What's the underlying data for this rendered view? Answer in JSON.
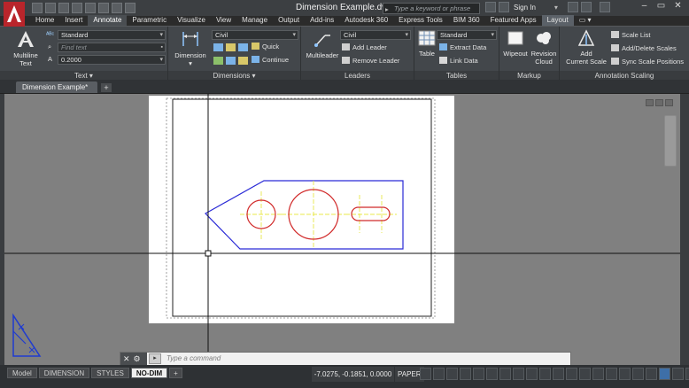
{
  "window": {
    "title": "Dimension Example.dwg"
  },
  "search": {
    "placeholder": "Type a keyword or phrase"
  },
  "account": {
    "signin_label": "Sign In"
  },
  "ribbon_tabs": [
    "Home",
    "Insert",
    "Annotate",
    "Parametric",
    "Visualize",
    "View",
    "Manage",
    "Output",
    "Add-ins",
    "Autodesk 360",
    "Express Tools",
    "BIM 360",
    "Featured Apps",
    "Layout"
  ],
  "active_tab": "Annotate",
  "panels": {
    "text": {
      "title": "Text",
      "multiline_label_1": "Multiline",
      "multiline_label_2": "Text",
      "style_value": "Standard",
      "find_placeholder": "Find text",
      "height_value": "0.2000"
    },
    "dimensions": {
      "title": "Dimensions",
      "dimension_label": "Dimension",
      "style_value": "Civil",
      "quick_label": "Quick",
      "continue_label": "Continue"
    },
    "leaders": {
      "title": "Leaders",
      "multileader_label": "Multileader",
      "style_value": "Civil",
      "add_leader_label": "Add Leader",
      "remove_leader_label": "Remove Leader"
    },
    "tables": {
      "title": "Tables",
      "table_label": "Table",
      "style_value": "Standard",
      "extract_data_label": "Extract Data",
      "link_data_label": "Link Data"
    },
    "markup": {
      "title": "Markup",
      "wipeout_label": "Wipeout",
      "revision_cloud_label_1": "Revision",
      "revision_cloud_label_2": "Cloud"
    },
    "annotation_scaling": {
      "title": "Annotation Scaling",
      "add_scale_label_1": "Add",
      "add_scale_label_2": "Current Scale",
      "scale_list_label": "Scale List",
      "add_delete_label": "Add/Delete Scales",
      "sync_label": "Sync Scale Positions"
    }
  },
  "document_tab": {
    "label": "Dimension Example*",
    "plus": "+"
  },
  "command_line": {
    "placeholder": "Type a command"
  },
  "layout_tabs": [
    "Model",
    "DIMENSION",
    "STYLES",
    "NO-DIM"
  ],
  "active_layout": "NO-DIM",
  "layout_tabs_plus": "+",
  "status": {
    "coordinates": "-7.0275, -0.1851, 0.0000",
    "space": "PAPER"
  },
  "colors": {
    "titlebar": "#3c3f42",
    "ribbon": "#43474b",
    "canvas": "#808080",
    "app_logo": "#b9252b",
    "drawing_outline": "#2a2ad6",
    "drawing_circle": "#d12a2a",
    "drawing_centerline": "#e8e84a"
  }
}
